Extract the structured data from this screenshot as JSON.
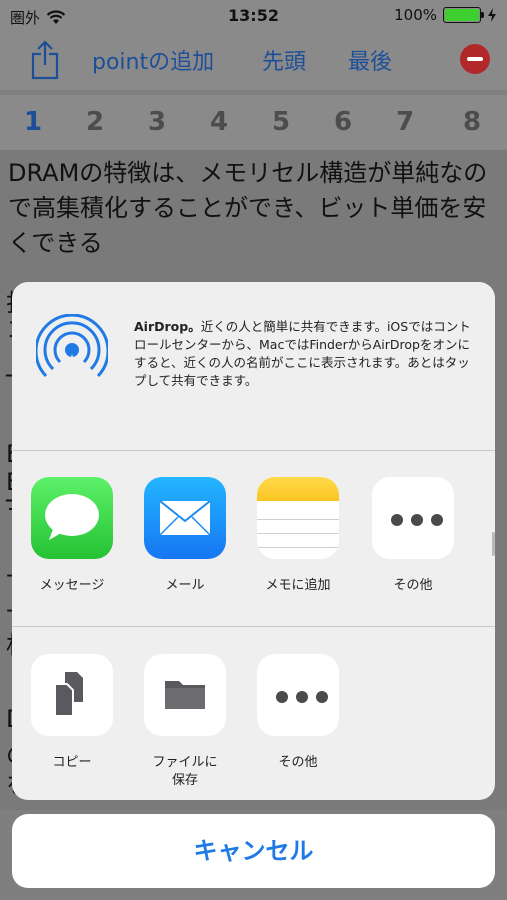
{
  "status": {
    "carrier": "圏外",
    "time": "13:52",
    "battery": "100%"
  },
  "toolbar": {
    "add_point": "pointの追加",
    "first": "先頭",
    "last": "最後"
  },
  "pages": [
    "1",
    "2",
    "3",
    "4",
    "5",
    "6",
    "7",
    "8"
  ],
  "content": {
    "paragraph": "DRAMの特徴は、メモリセル構造が単純なので高集積化することができ、ビット単価を安くできる",
    "fragments": [
      "打",
      "コ",
      "T",
      "E",
      "E",
      "Ŧ",
      "-",
      "-",
      "材",
      "D",
      "の",
      "を"
    ]
  },
  "share_sheet": {
    "airdrop_title": "AirDrop。",
    "airdrop_text": "近くの人と簡単に共有できます。iOSではコントロールセンターから、MacではFinderからAirDropをオンにすると、近くの人の名前がここに表示されます。あとはタップして共有できます。",
    "apps": [
      {
        "label": "メッセージ",
        "icon": "messages-icon"
      },
      {
        "label": "メール",
        "icon": "mail-icon"
      },
      {
        "label": "メモに追加",
        "icon": "notes-icon"
      },
      {
        "label": "その他",
        "icon": "more-icon"
      }
    ],
    "actions": [
      {
        "label": "コピー",
        "icon": "copy-icon"
      },
      {
        "label": "ファイルに\n保存",
        "icon": "folder-icon"
      },
      {
        "label": "その他",
        "icon": "more-icon"
      }
    ]
  },
  "cancel_label": "キャンセル",
  "colors": {
    "accent": "#1f7ae6",
    "toolbar_text": "#1d4f99",
    "remove": "#b2282a"
  }
}
